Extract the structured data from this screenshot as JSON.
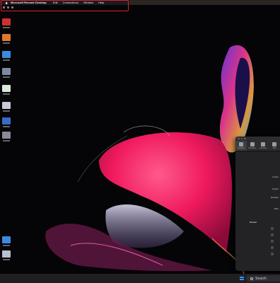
{
  "menubar": {
    "app_name": "Microsoft Remote Desktop",
    "items": [
      "Edit",
      "Connections",
      "Window",
      "Help"
    ]
  },
  "prefs": {
    "tabs": [
      {
        "label": "General",
        "icon": "gear-icon",
        "active": true
      },
      {
        "label": "Windows",
        "icon": "windows-icon",
        "active": false
      },
      {
        "label": "Monitors",
        "icon": "monitor-icon",
        "active": false
      },
      {
        "label": "Tabs",
        "icon": "tabs-icon",
        "active": false
      }
    ],
    "rows": [
      "Import",
      "Export",
      "Desktop",
      "After",
      "Screen"
    ]
  },
  "taskbar": {
    "search_label": "Search"
  },
  "colors": {
    "highlight": "#e0202b",
    "windows_blue": "#3d8ee8",
    "wallpaper_petal": "#ff2a6e"
  }
}
